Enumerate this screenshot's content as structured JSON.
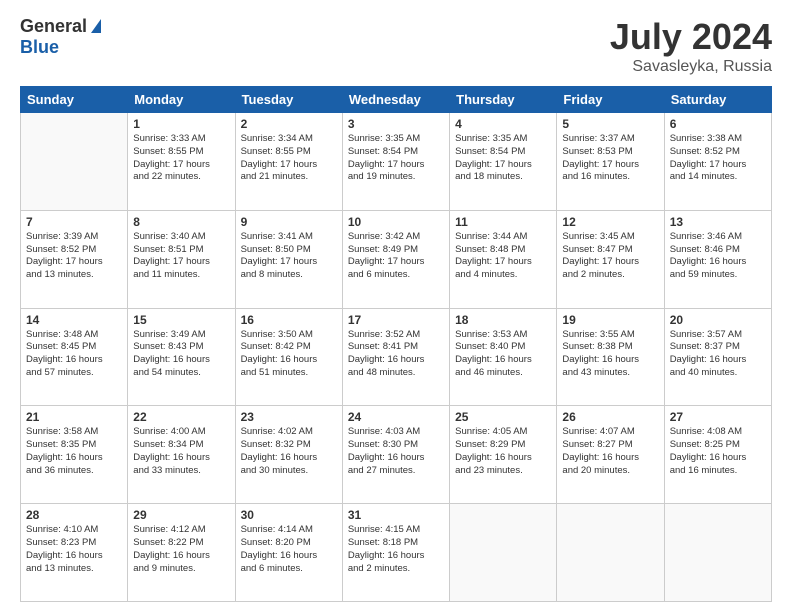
{
  "header": {
    "logo_general": "General",
    "logo_blue": "Blue",
    "title": "July 2024",
    "location": "Savasleyka, Russia"
  },
  "columns": [
    "Sunday",
    "Monday",
    "Tuesday",
    "Wednesday",
    "Thursday",
    "Friday",
    "Saturday"
  ],
  "weeks": [
    [
      {
        "day": "",
        "info": ""
      },
      {
        "day": "1",
        "info": "Sunrise: 3:33 AM\nSunset: 8:55 PM\nDaylight: 17 hours\nand 22 minutes."
      },
      {
        "day": "2",
        "info": "Sunrise: 3:34 AM\nSunset: 8:55 PM\nDaylight: 17 hours\nand 21 minutes."
      },
      {
        "day": "3",
        "info": "Sunrise: 3:35 AM\nSunset: 8:54 PM\nDaylight: 17 hours\nand 19 minutes."
      },
      {
        "day": "4",
        "info": "Sunrise: 3:35 AM\nSunset: 8:54 PM\nDaylight: 17 hours\nand 18 minutes."
      },
      {
        "day": "5",
        "info": "Sunrise: 3:37 AM\nSunset: 8:53 PM\nDaylight: 17 hours\nand 16 minutes."
      },
      {
        "day": "6",
        "info": "Sunrise: 3:38 AM\nSunset: 8:52 PM\nDaylight: 17 hours\nand 14 minutes."
      }
    ],
    [
      {
        "day": "7",
        "info": "Sunrise: 3:39 AM\nSunset: 8:52 PM\nDaylight: 17 hours\nand 13 minutes."
      },
      {
        "day": "8",
        "info": "Sunrise: 3:40 AM\nSunset: 8:51 PM\nDaylight: 17 hours\nand 11 minutes."
      },
      {
        "day": "9",
        "info": "Sunrise: 3:41 AM\nSunset: 8:50 PM\nDaylight: 17 hours\nand 8 minutes."
      },
      {
        "day": "10",
        "info": "Sunrise: 3:42 AM\nSunset: 8:49 PM\nDaylight: 17 hours\nand 6 minutes."
      },
      {
        "day": "11",
        "info": "Sunrise: 3:44 AM\nSunset: 8:48 PM\nDaylight: 17 hours\nand 4 minutes."
      },
      {
        "day": "12",
        "info": "Sunrise: 3:45 AM\nSunset: 8:47 PM\nDaylight: 17 hours\nand 2 minutes."
      },
      {
        "day": "13",
        "info": "Sunrise: 3:46 AM\nSunset: 8:46 PM\nDaylight: 16 hours\nand 59 minutes."
      }
    ],
    [
      {
        "day": "14",
        "info": "Sunrise: 3:48 AM\nSunset: 8:45 PM\nDaylight: 16 hours\nand 57 minutes."
      },
      {
        "day": "15",
        "info": "Sunrise: 3:49 AM\nSunset: 8:43 PM\nDaylight: 16 hours\nand 54 minutes."
      },
      {
        "day": "16",
        "info": "Sunrise: 3:50 AM\nSunset: 8:42 PM\nDaylight: 16 hours\nand 51 minutes."
      },
      {
        "day": "17",
        "info": "Sunrise: 3:52 AM\nSunset: 8:41 PM\nDaylight: 16 hours\nand 48 minutes."
      },
      {
        "day": "18",
        "info": "Sunrise: 3:53 AM\nSunset: 8:40 PM\nDaylight: 16 hours\nand 46 minutes."
      },
      {
        "day": "19",
        "info": "Sunrise: 3:55 AM\nSunset: 8:38 PM\nDaylight: 16 hours\nand 43 minutes."
      },
      {
        "day": "20",
        "info": "Sunrise: 3:57 AM\nSunset: 8:37 PM\nDaylight: 16 hours\nand 40 minutes."
      }
    ],
    [
      {
        "day": "21",
        "info": "Sunrise: 3:58 AM\nSunset: 8:35 PM\nDaylight: 16 hours\nand 36 minutes."
      },
      {
        "day": "22",
        "info": "Sunrise: 4:00 AM\nSunset: 8:34 PM\nDaylight: 16 hours\nand 33 minutes."
      },
      {
        "day": "23",
        "info": "Sunrise: 4:02 AM\nSunset: 8:32 PM\nDaylight: 16 hours\nand 30 minutes."
      },
      {
        "day": "24",
        "info": "Sunrise: 4:03 AM\nSunset: 8:30 PM\nDaylight: 16 hours\nand 27 minutes."
      },
      {
        "day": "25",
        "info": "Sunrise: 4:05 AM\nSunset: 8:29 PM\nDaylight: 16 hours\nand 23 minutes."
      },
      {
        "day": "26",
        "info": "Sunrise: 4:07 AM\nSunset: 8:27 PM\nDaylight: 16 hours\nand 20 minutes."
      },
      {
        "day": "27",
        "info": "Sunrise: 4:08 AM\nSunset: 8:25 PM\nDaylight: 16 hours\nand 16 minutes."
      }
    ],
    [
      {
        "day": "28",
        "info": "Sunrise: 4:10 AM\nSunset: 8:23 PM\nDaylight: 16 hours\nand 13 minutes."
      },
      {
        "day": "29",
        "info": "Sunrise: 4:12 AM\nSunset: 8:22 PM\nDaylight: 16 hours\nand 9 minutes."
      },
      {
        "day": "30",
        "info": "Sunrise: 4:14 AM\nSunset: 8:20 PM\nDaylight: 16 hours\nand 6 minutes."
      },
      {
        "day": "31",
        "info": "Sunrise: 4:15 AM\nSunset: 8:18 PM\nDaylight: 16 hours\nand 2 minutes."
      },
      {
        "day": "",
        "info": ""
      },
      {
        "day": "",
        "info": ""
      },
      {
        "day": "",
        "info": ""
      }
    ]
  ]
}
